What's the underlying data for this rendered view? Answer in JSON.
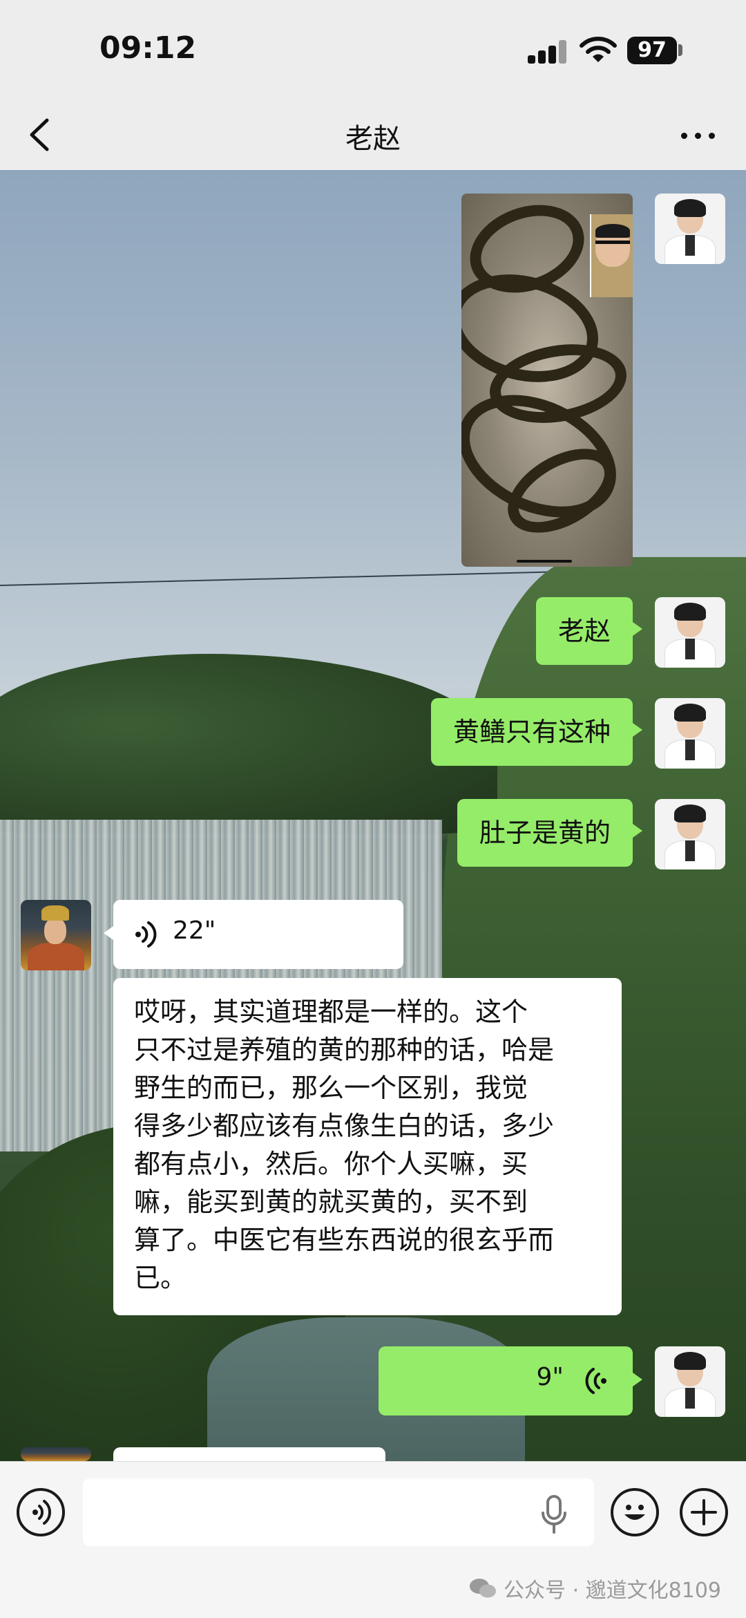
{
  "status_bar": {
    "time": "09:12",
    "battery": "97"
  },
  "header": {
    "title": "老赵"
  },
  "messages": {
    "text_1": "老赵",
    "text_2": "黄鳝只有这种",
    "text_3": "肚子是黄的",
    "voice_in_duration": "22\"",
    "transcript_lines": [
      "哎呀，其实道理都是一样的。这个",
      "只不过是养殖的黄的那种的话，哈是",
      "野生的而已，那么一个区别，我觉",
      "得多少都应该有点像生白的话，多少",
      "都有点小，然后。你个人买嘛，买",
      "嘛，能买到黄的就买黄的，买不到",
      "算了。中医它有些东西说的很玄乎而",
      "已。"
    ],
    "voice_out_duration": "9\""
  },
  "input_bar": {
    "placeholder": ""
  },
  "watermark": {
    "text": "公众号 · 邈道文化8109"
  },
  "icons": {
    "back": "chevron-left-icon",
    "more": "more-icon",
    "voice": "voice-icon",
    "emoji": "emoji-icon",
    "add": "plus-icon",
    "mic": "mic-icon"
  }
}
